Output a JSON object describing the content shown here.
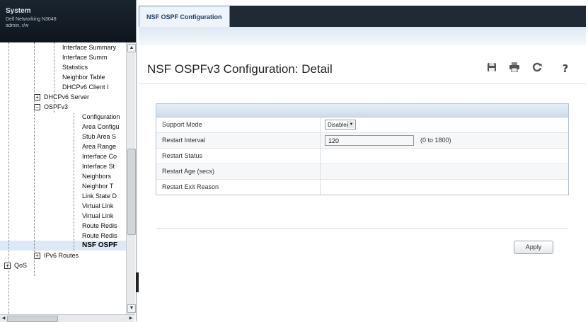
{
  "header": {
    "title": "System",
    "subtitle_line1": "Dell Networking N3048",
    "subtitle_line2": "admin, r/w"
  },
  "tree": {
    "items": [
      {
        "label": "Interface Summary",
        "level": 3
      },
      {
        "label": "Interface Summ",
        "level": 3
      },
      {
        "label": "Statistics",
        "level": 3
      },
      {
        "label": "Neighbor Table",
        "level": 3
      },
      {
        "label": "DHCPv6 Client I",
        "level": 3
      },
      {
        "label": "DHCPv6 Server",
        "level": 2,
        "expander": "+"
      },
      {
        "label": "OSPFv3",
        "level": 2,
        "expander": "−"
      },
      {
        "label": "Configuration",
        "level": 4
      },
      {
        "label": "Area Configu",
        "level": 4
      },
      {
        "label": "Stub Area S",
        "level": 4
      },
      {
        "label": "Area Range",
        "level": 4
      },
      {
        "label": "Interface Co",
        "level": 4
      },
      {
        "label": "Interface St",
        "level": 4
      },
      {
        "label": "Neighbors",
        "level": 4
      },
      {
        "label": "Neighbor T",
        "level": 4
      },
      {
        "label": "Link State D",
        "level": 4
      },
      {
        "label": "Virtual Link",
        "level": 4
      },
      {
        "label": "Virtual Link",
        "level": 4
      },
      {
        "label": "Route Redis",
        "level": 4
      },
      {
        "label": "Route Redis",
        "level": 4
      },
      {
        "label": "NSF OSPF",
        "level": 4,
        "selected": true
      },
      {
        "label": "IPv6 Routes",
        "level": 2,
        "expander": "+"
      },
      {
        "label": "QoS",
        "level": 1,
        "expander": "+"
      }
    ]
  },
  "tab": {
    "label": "NSF OSPF Configuration"
  },
  "page": {
    "title": "NSF OSPFv3 Configuration: Detail"
  },
  "toolbar": {
    "save_icon": "save-icon",
    "print_icon": "print-icon",
    "refresh_icon": "refresh-icon",
    "help_icon": "help-icon"
  },
  "form": {
    "support_mode_label": "Support Mode",
    "support_mode_value": "Disabled",
    "restart_interval_label": "Restart Interval",
    "restart_interval_value": "120",
    "restart_interval_range": "(0 to 1800)",
    "restart_status_label": "Restart Status",
    "restart_age_label": "Restart Age (secs)",
    "restart_exit_reason_label": "Restart Exit Reason"
  },
  "apply_label": "Apply"
}
